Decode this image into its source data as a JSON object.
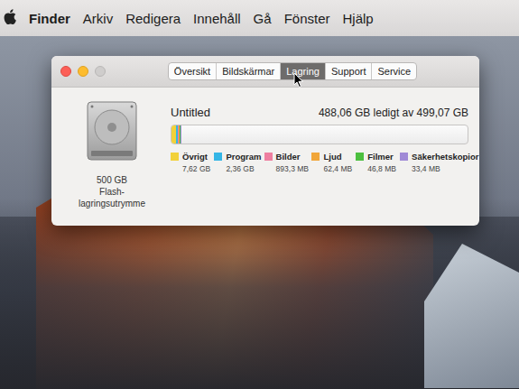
{
  "menu_bar": {
    "app": "Finder",
    "items": [
      "Arkiv",
      "Redigera",
      "Innehåll",
      "Gå",
      "Fönster",
      "Hjälp"
    ]
  },
  "window": {
    "tabs": [
      {
        "label": "Översikt",
        "selected": false
      },
      {
        "label": "Bildskärmar",
        "selected": false
      },
      {
        "label": "Lagring",
        "selected": true
      },
      {
        "label": "Support",
        "selected": false
      },
      {
        "label": "Service",
        "selected": false
      }
    ],
    "disk": {
      "label_lines": [
        "500 GB",
        "Flash-",
        "lagringsutrymme"
      ]
    },
    "volume": {
      "name": "Untitled",
      "free": "488,06 GB ledigt av 499,07 GB"
    },
    "categories": [
      {
        "name": "Övrigt",
        "size": "7,62 GB",
        "color": "#f2d13a",
        "level": 0.0153
      },
      {
        "name": "Program",
        "size": "2,36 GB",
        "color": "#35b6e6",
        "level": 0.0047
      },
      {
        "name": "Bilder",
        "size": "893,3 MB",
        "color": "#ee7fa0",
        "level": 0.0018
      },
      {
        "name": "Ljud",
        "size": "62,4 MB",
        "color": "#f1a63a",
        "level": 0.0001
      },
      {
        "name": "Filmer",
        "size": "46,8 MB",
        "color": "#4cbf3f",
        "level": 0.0001
      },
      {
        "name": "Säkerhetskopior",
        "size": "33,4 MB",
        "color": "#a08ad6",
        "level": 0.0001
      }
    ]
  }
}
